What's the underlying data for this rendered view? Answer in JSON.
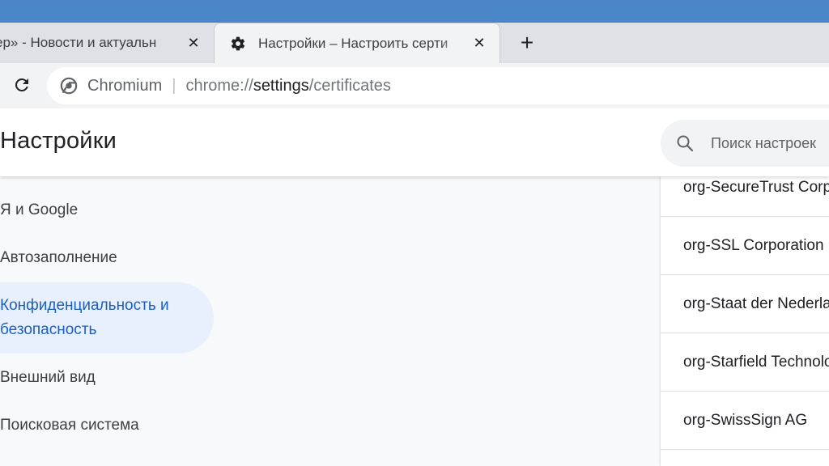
{
  "browser": {
    "tabs": [
      {
        "title": "ер» - Новости и актуальн",
        "close": "✕",
        "active": false
      },
      {
        "title": "Настройки – Настроить серти",
        "close": "✕",
        "active": true,
        "icon": "gear-icon"
      }
    ],
    "new_tab": "+",
    "omnibox": {
      "site_name": "Chromium",
      "separator": "|",
      "url_scheme": "chrome://",
      "url_host": "settings",
      "url_path": "/certificates",
      "icon": "chromium-icon"
    }
  },
  "settings": {
    "title": "Настройки",
    "search_placeholder": "Поиск настроек",
    "sidebar": [
      {
        "label": "Я и Google",
        "active": false
      },
      {
        "label": "Автозаполнение",
        "active": false
      },
      {
        "label": "Конфиденциальность и безопасность",
        "line1": "Конфиденциальность и",
        "line2": "безопасность",
        "active": true
      },
      {
        "label": "Внешний вид",
        "active": false
      },
      {
        "label": "Поисковая система",
        "active": false
      }
    ],
    "certificates": [
      "org-SecureTrust Corporation",
      "org-SSL Corporation",
      "org-Staat der Nederlanden",
      "org-Starfield Technologies",
      "org-SwissSign AG"
    ]
  },
  "colors": {
    "accent": "#1a5fc4",
    "active_bg": "#e8f0fe",
    "title_bar": "#4a86c8"
  }
}
